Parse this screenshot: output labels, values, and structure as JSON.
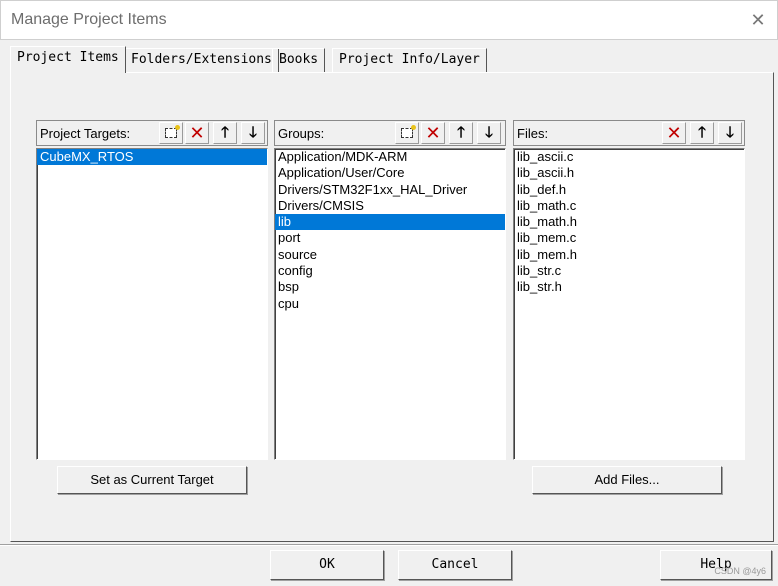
{
  "window": {
    "title": "Manage Project Items",
    "close_glyph": "✕"
  },
  "tabs": [
    {
      "label": "Project Items",
      "active": true
    },
    {
      "label": "Folders/Extensions",
      "active": false
    },
    {
      "label": "Books",
      "active": false
    },
    {
      "label": "Project Info/Layer",
      "active": false
    }
  ],
  "targets": {
    "header": "Project Targets:",
    "items": [
      {
        "label": "CubeMX_RTOS",
        "selected": true
      }
    ],
    "tools": [
      "new-icon",
      "delete-icon",
      "move-up-icon",
      "move-down-icon"
    ]
  },
  "groups": {
    "header": "Groups:",
    "items": [
      {
        "label": "Application/MDK-ARM"
      },
      {
        "label": "Application/User/Core"
      },
      {
        "label": "Drivers/STM32F1xx_HAL_Driver"
      },
      {
        "label": "Drivers/CMSIS"
      },
      {
        "label": "lib",
        "selected": true
      },
      {
        "label": "port"
      },
      {
        "label": "source"
      },
      {
        "label": "config"
      },
      {
        "label": "bsp"
      },
      {
        "label": "cpu"
      }
    ],
    "tools": [
      "new-icon",
      "delete-icon",
      "move-up-icon",
      "move-down-icon"
    ]
  },
  "files": {
    "header": "Files:",
    "items": [
      {
        "label": "lib_ascii.c"
      },
      {
        "label": "lib_ascii.h"
      },
      {
        "label": "lib_def.h"
      },
      {
        "label": "lib_math.c"
      },
      {
        "label": "lib_math.h"
      },
      {
        "label": "lib_mem.c"
      },
      {
        "label": "lib_mem.h"
      },
      {
        "label": "lib_str.c"
      },
      {
        "label": "lib_str.h"
      }
    ],
    "tools": [
      "delete-icon",
      "move-up-icon",
      "move-down-icon"
    ]
  },
  "buttons": {
    "set_target": "Set as Current Target",
    "add_files": "Add Files...",
    "ok": "OK",
    "cancel": "Cancel",
    "help": "Help"
  },
  "watermark": "CSDN @4y6"
}
